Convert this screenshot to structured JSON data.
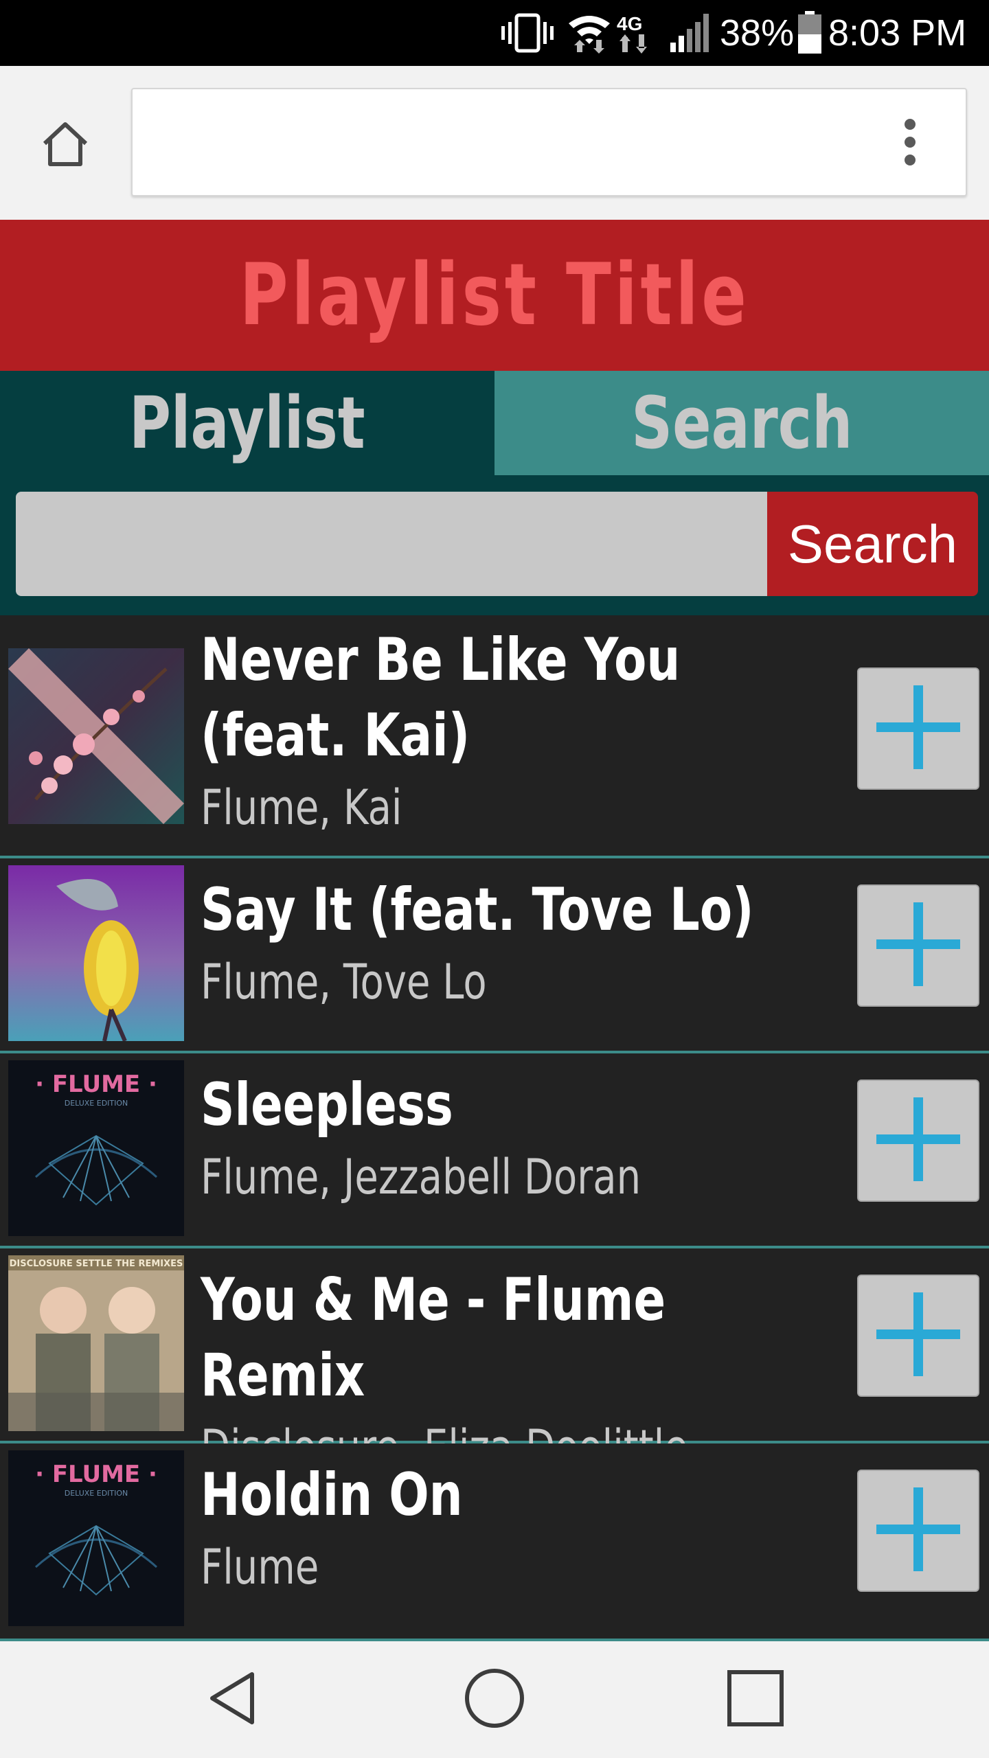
{
  "status_bar": {
    "battery_percent": "38%",
    "time": "8:03 PM",
    "network_label": "4G",
    "icons": [
      "vibrate-icon",
      "wifi-icon",
      "lte-icon",
      "signal-icon",
      "battery-icon"
    ]
  },
  "browser": {
    "url_value": "",
    "icons": [
      "home-icon",
      "overflow-menu-icon"
    ]
  },
  "header": {
    "title": "Playlist Title"
  },
  "tabs": [
    {
      "label": "Playlist",
      "active": false
    },
    {
      "label": "Search",
      "active": true
    }
  ],
  "search": {
    "query": "",
    "button_label": "Search"
  },
  "results": [
    {
      "title": "Never Be Like You (feat. Kai)",
      "artist": "Flume, Kai",
      "cover": "never-be-like-you-cover"
    },
    {
      "title": "Say It (feat. Tove Lo)",
      "artist": "Flume, Tove Lo",
      "cover": "say-it-cover"
    },
    {
      "title": "Sleepless",
      "artist": "Flume, Jezzabell Doran",
      "cover": "flume-deluxe-cover"
    },
    {
      "title": "You & Me - Flume Remix",
      "artist": "Disclosure, Eliza Doolittle",
      "cover": "settle-remixes-cover"
    },
    {
      "title": "Holdin On",
      "artist": "Flume",
      "cover": "flume-deluxe-cover"
    }
  ],
  "cover_text": {
    "flume_logo": "· FLUME ·",
    "flume_sub": "DELUXE EDITION",
    "disclosure_banner": "DISCLOSURE SETTLE THE REMIXES"
  },
  "nav": {
    "icons": [
      "back-icon",
      "home-circle-icon",
      "recents-icon"
    ]
  },
  "colors": {
    "brand_red": "#b21e22",
    "title_pink": "#f25a5c",
    "tab_dark_teal": "#053e40",
    "tab_active_teal": "#3c8c89",
    "plus_blue": "#2aa9d6",
    "list_bg": "#222222"
  }
}
